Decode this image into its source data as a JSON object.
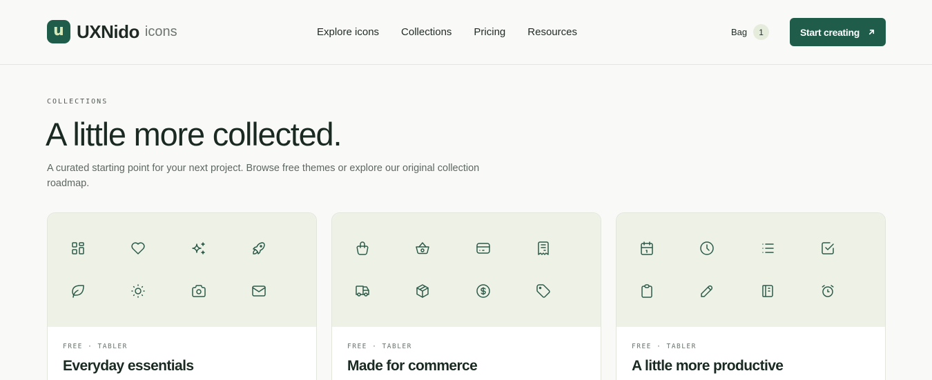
{
  "brand": {
    "mark": "u",
    "name": "UXNido",
    "sub": "icons"
  },
  "nav": [
    "Explore icons",
    "Collections",
    "Pricing",
    "Resources"
  ],
  "bag": {
    "label": "Bag",
    "count": "1"
  },
  "cta": {
    "label": "Start creating",
    "icon": "arrow-up-right-icon"
  },
  "section": {
    "eyebrow": "COLLECTIONS",
    "title": "A little more collected.",
    "description": "A curated starting point for your next project. Browse free themes or explore our original collection roadmap."
  },
  "colors": {
    "accent": "#1f5c4a",
    "preview_bg": "#eef2e6",
    "page_bg": "#f9f9f7"
  },
  "cards": [
    {
      "meta": "FREE · TABLER",
      "title": "Everyday essentials",
      "icons": [
        "layout-grid-icon",
        "heart-icon",
        "sparkles-icon",
        "rocket-icon",
        "leaf-icon",
        "sun-icon",
        "camera-icon",
        "mail-icon"
      ]
    },
    {
      "meta": "FREE · TABLER",
      "title": "Made for commerce",
      "icons": [
        "shopping-bag-icon",
        "basket-icon",
        "credit-card-icon",
        "receipt-icon",
        "truck-icon",
        "package-icon",
        "coin-icon",
        "tag-icon"
      ]
    },
    {
      "meta": "FREE · TABLER",
      "title": "A little more productive",
      "icons": [
        "calendar-icon",
        "clock-icon",
        "list-icon",
        "square-check-icon",
        "clipboard-icon",
        "pencil-icon",
        "notebook-icon",
        "alarm-icon"
      ]
    }
  ]
}
